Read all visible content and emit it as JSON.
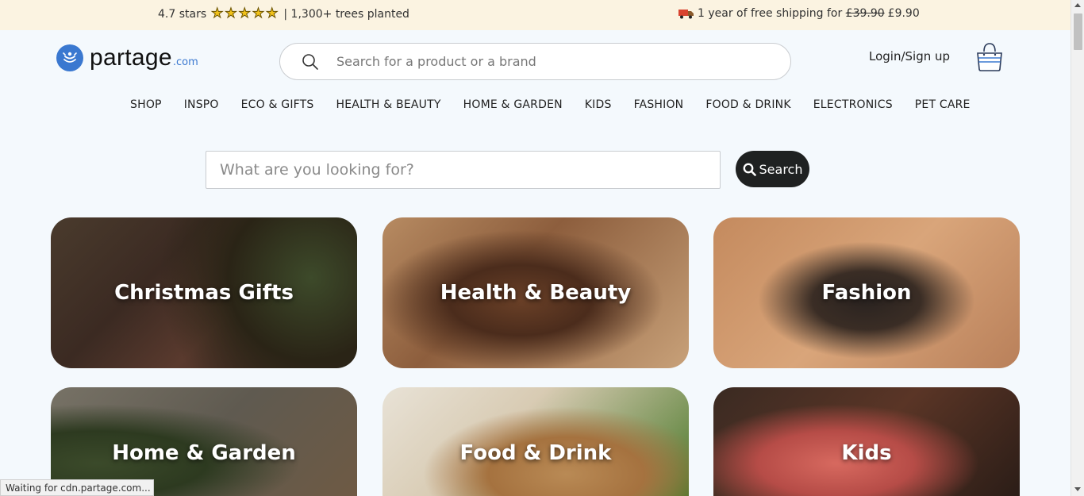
{
  "topbar": {
    "rating_text": "4.7 stars",
    "stars_count": 5,
    "trees_text": "| 1,300+ trees planted",
    "shipping_text": "1 year of free shipping for",
    "old_price": "£39.90",
    "new_price": "£9.90"
  },
  "logo": {
    "main": "partage",
    "suffix": ".com"
  },
  "header_search": {
    "placeholder": "Search for a product or a brand"
  },
  "account": {
    "login_label": "Login/Sign up"
  },
  "nav": {
    "items": [
      "SHOP",
      "INSPO",
      "ECO & GIFTS",
      "HEALTH & BEAUTY",
      "HOME & GARDEN",
      "KIDS",
      "FASHION",
      "FOOD & DRINK",
      "ELECTRONICS",
      "PET CARE"
    ]
  },
  "main_search": {
    "placeholder": "What are you looking for?",
    "button_label": "Search"
  },
  "categories": [
    {
      "title": "Christmas Gifts"
    },
    {
      "title": "Health & Beauty"
    },
    {
      "title": "Fashion"
    },
    {
      "title": "Home & Garden"
    },
    {
      "title": "Food & Drink"
    },
    {
      "title": "Kids"
    }
  ],
  "status_bar": {
    "text": "Waiting for cdn.partage.com..."
  },
  "colors": {
    "accent": "#3a78d0",
    "topbar_bg": "#fbf3e1",
    "button_dark": "#1f2121"
  }
}
